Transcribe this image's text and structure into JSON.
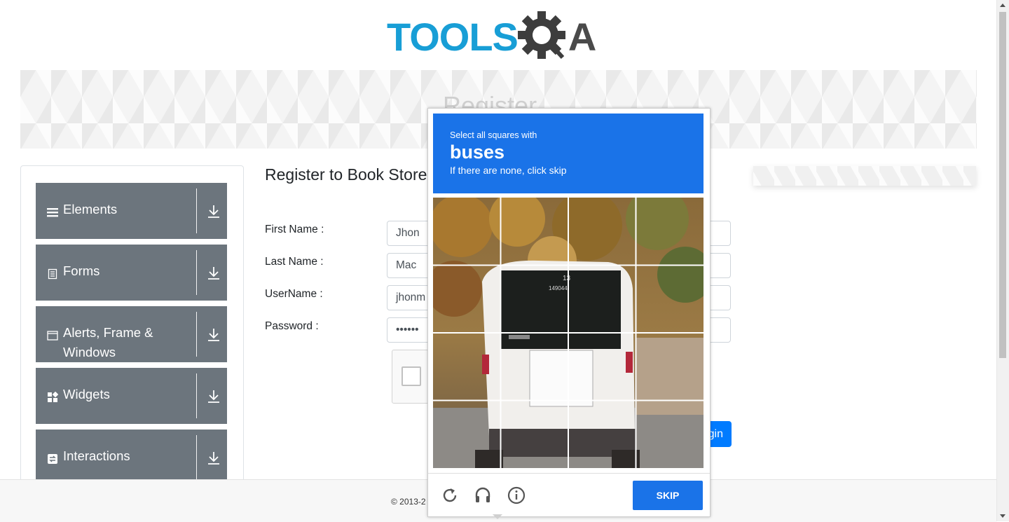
{
  "header": {
    "logo_text_main": "TOOLS",
    "logo_text_end": "A"
  },
  "banner": {
    "title": "Register"
  },
  "sidebar": {
    "groups": [
      {
        "label": "Elements",
        "icon": "menu-icon"
      },
      {
        "label": "Forms",
        "icon": "document-icon"
      },
      {
        "label": "Alerts, Frame & Windows",
        "icon": "window-icon"
      },
      {
        "label": "Widgets",
        "icon": "widgets-icon"
      },
      {
        "label": "Interactions",
        "icon": "interactions-icon"
      }
    ]
  },
  "form": {
    "title": "Register to Book Store",
    "fields": [
      {
        "label": "First Name :",
        "value": "Jhon"
      },
      {
        "label": "Last Name :",
        "value": "Mac"
      },
      {
        "label": "UserName :",
        "value": "jhonm"
      },
      {
        "label": "Password :",
        "value": "••••••"
      }
    ],
    "login_label": "gin"
  },
  "footer": {
    "copyright": "© 2013-2"
  },
  "captcha": {
    "instruction": "Select all squares with",
    "target": "buses",
    "hint": "If there are none, click skip",
    "skip_label": "SKIP",
    "colors": {
      "header": "#1a73e8"
    }
  }
}
